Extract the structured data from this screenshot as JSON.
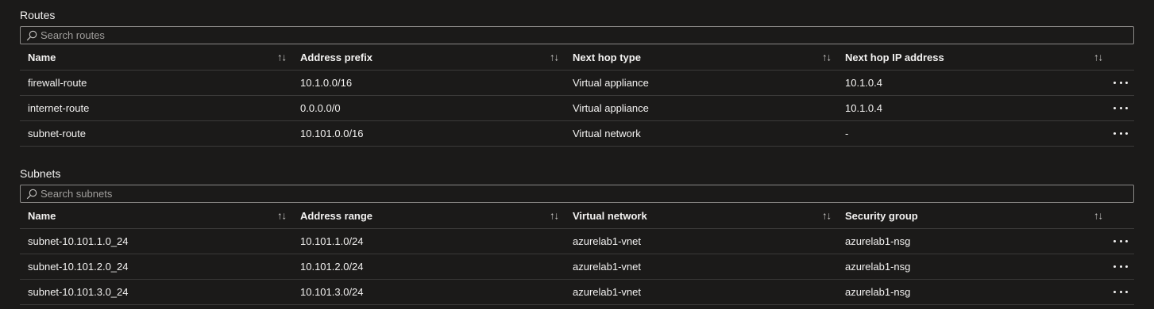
{
  "routes": {
    "title": "Routes",
    "search_placeholder": "Search routes",
    "columns": [
      "Name",
      "Address prefix",
      "Next hop type",
      "Next hop IP address"
    ],
    "rows": [
      [
        "firewall-route",
        "10.1.0.0/16",
        "Virtual appliance",
        "10.1.0.4"
      ],
      [
        "internet-route",
        "0.0.0.0/0",
        "Virtual appliance",
        "10.1.0.4"
      ],
      [
        "subnet-route",
        "10.101.0.0/16",
        "Virtual network",
        "-"
      ]
    ]
  },
  "subnets": {
    "title": "Subnets",
    "search_placeholder": "Search subnets",
    "columns": [
      "Name",
      "Address range",
      "Virtual network",
      "Security group"
    ],
    "rows": [
      [
        "subnet-10.101.1.0_24",
        "10.101.1.0/24",
        "azurelab1-vnet",
        "azurelab1-nsg"
      ],
      [
        "subnet-10.101.2.0_24",
        "10.101.2.0/24",
        "azurelab1-vnet",
        "azurelab1-nsg"
      ],
      [
        "subnet-10.101.3.0_24",
        "10.101.3.0/24",
        "azurelab1-vnet",
        "azurelab1-nsg"
      ]
    ]
  },
  "icons": {
    "sort": "sort-icon",
    "search": "search-icon",
    "more": "more-icon"
  },
  "colors": {
    "background": "#1b1a19",
    "text": "#f3f2f1",
    "border": "#8a8886",
    "divider": "#3b3a39",
    "placeholder": "#a19f9d"
  }
}
